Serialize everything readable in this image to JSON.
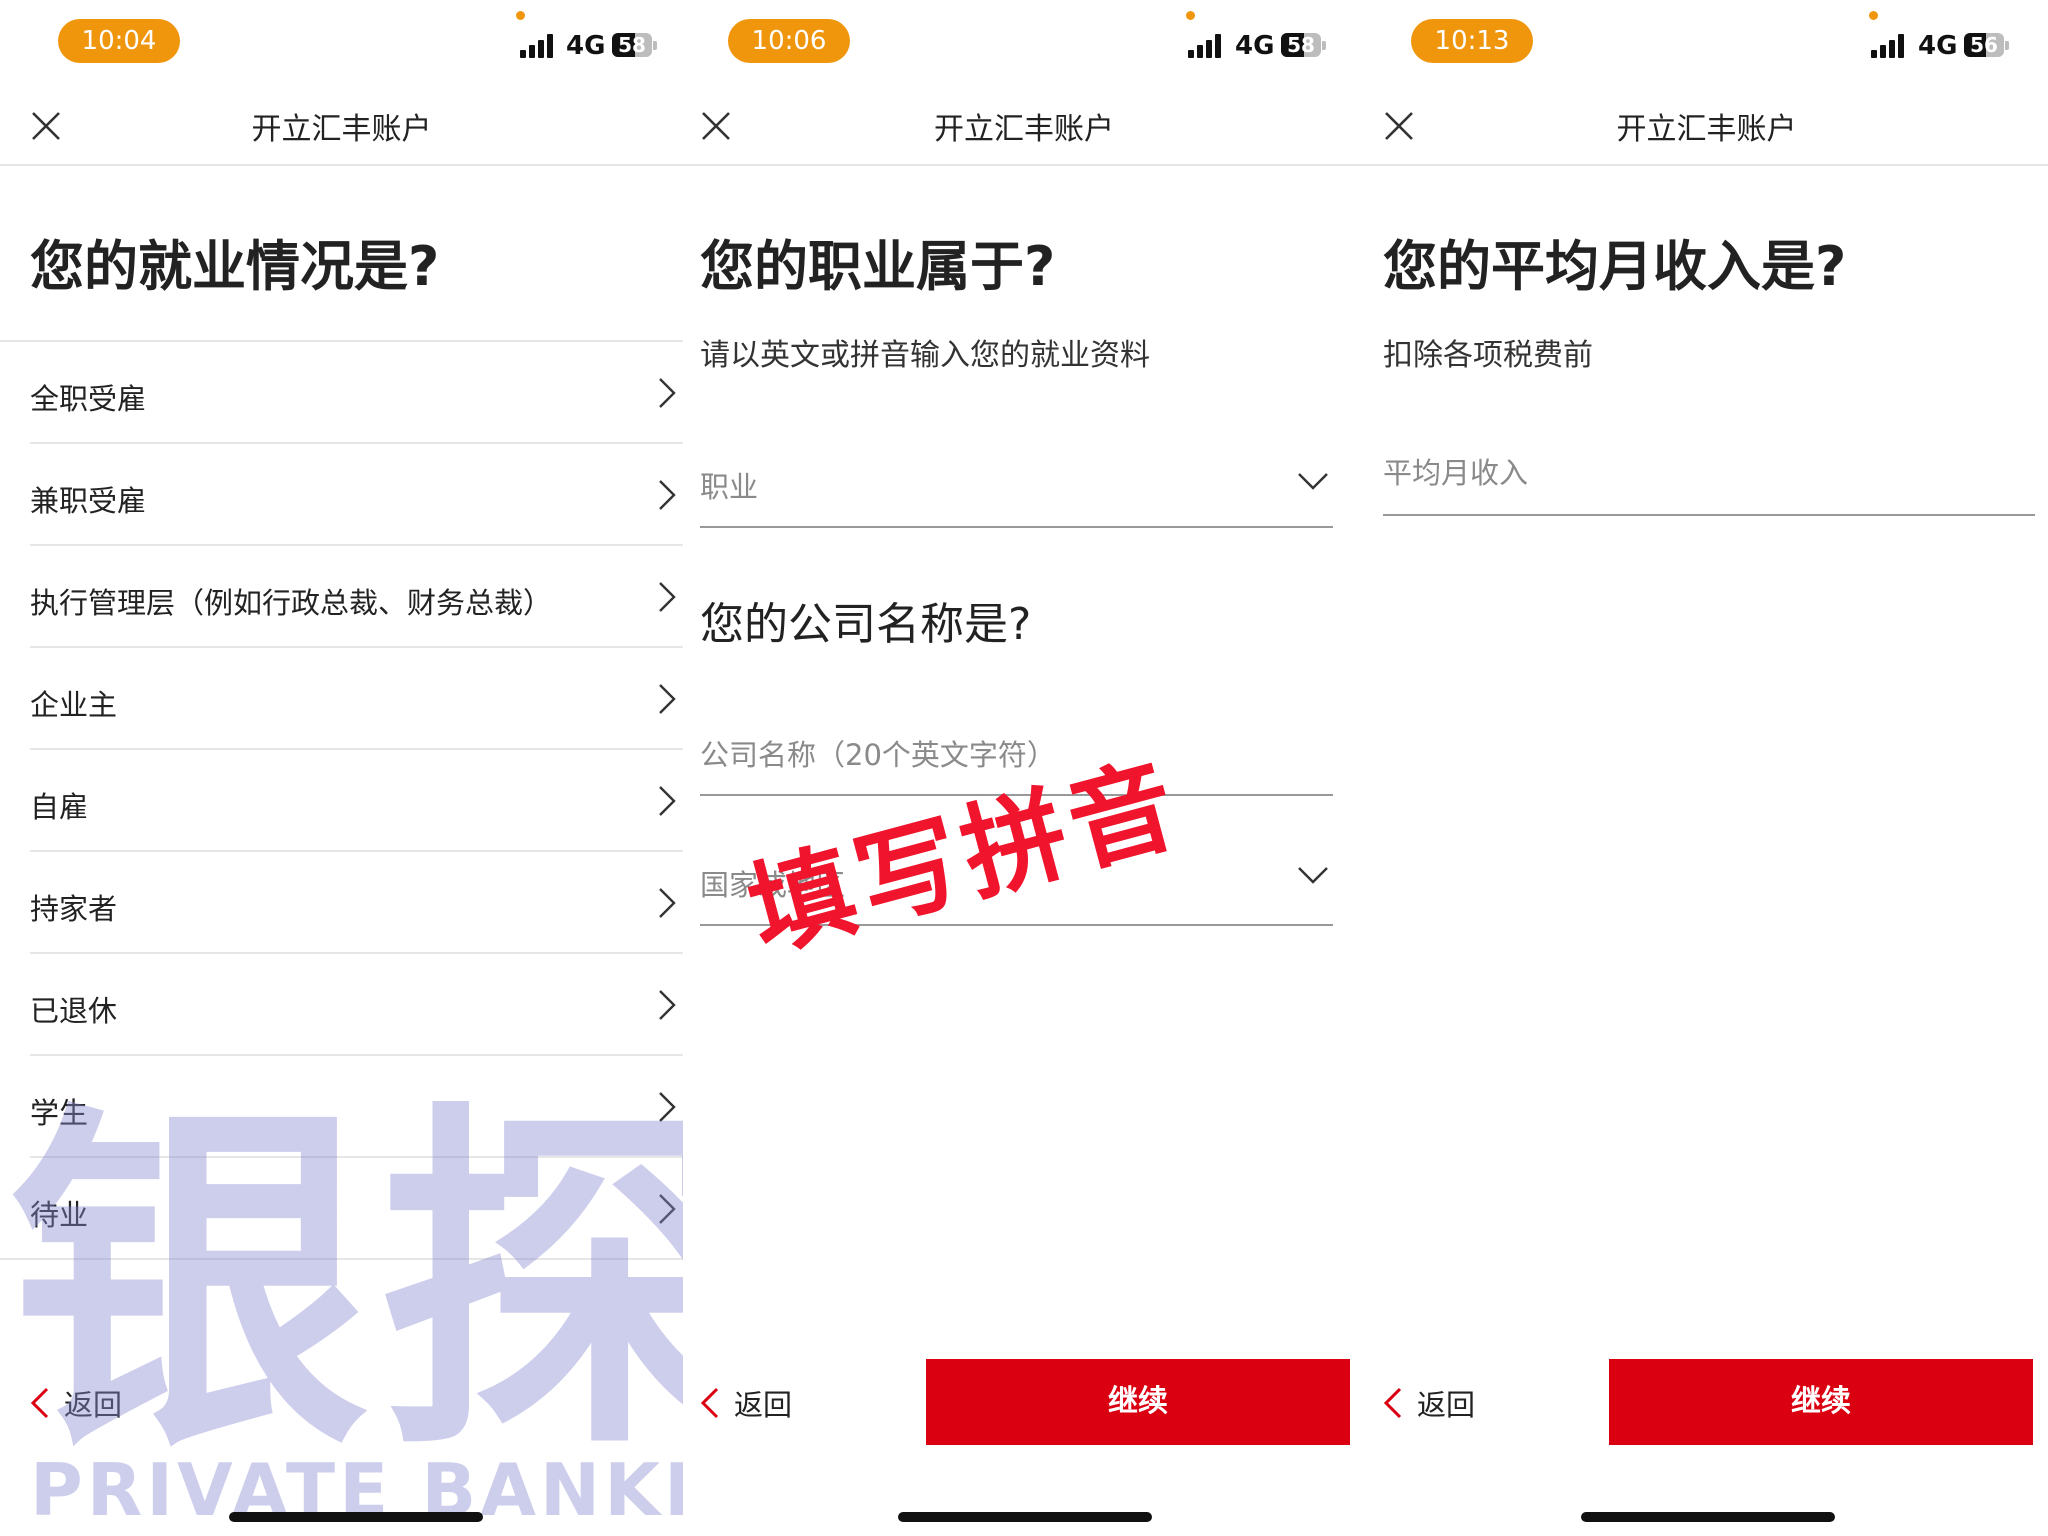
{
  "colors": {
    "status_pill": "#f0960d",
    "accent_red": "#db0011",
    "stamp_red": "#f0142c",
    "watermark": "#8787d2"
  },
  "header_title": "开立汇丰账户",
  "back_label": "返回",
  "continue_label": "继续",
  "network": "4G",
  "panels": [
    {
      "status": {
        "time": "10:04",
        "battery": "58",
        "battery_level": 0.58
      },
      "title": "您的就业情况是?",
      "options": [
        "全职受雇",
        "兼职受雇",
        "执行管理层（例如行政总裁、财务总裁）",
        "企业主",
        "自雇",
        "持家者",
        "已退休",
        "学生",
        "待业"
      ]
    },
    {
      "status": {
        "time": "10:06",
        "battery": "58",
        "battery_level": 0.58
      },
      "title": "您的职业属于?",
      "subtitle": "请以英文或拼音输入您的就业资料",
      "occupation_placeholder": "职业",
      "company_section_title": "您的公司名称是?",
      "company_placeholder": "公司名称（20个英文字符）",
      "country_placeholder": "国家或地区"
    },
    {
      "status": {
        "time": "10:13",
        "battery": "56",
        "battery_level": 0.56
      },
      "title": "您的平均月收入是?",
      "subtitle": "扣除各项税费前",
      "income_placeholder": "平均月收入"
    }
  ],
  "annotation": "填写拼音",
  "watermark": {
    "logo": "银探",
    "text": "PRIVATE BANKER"
  }
}
